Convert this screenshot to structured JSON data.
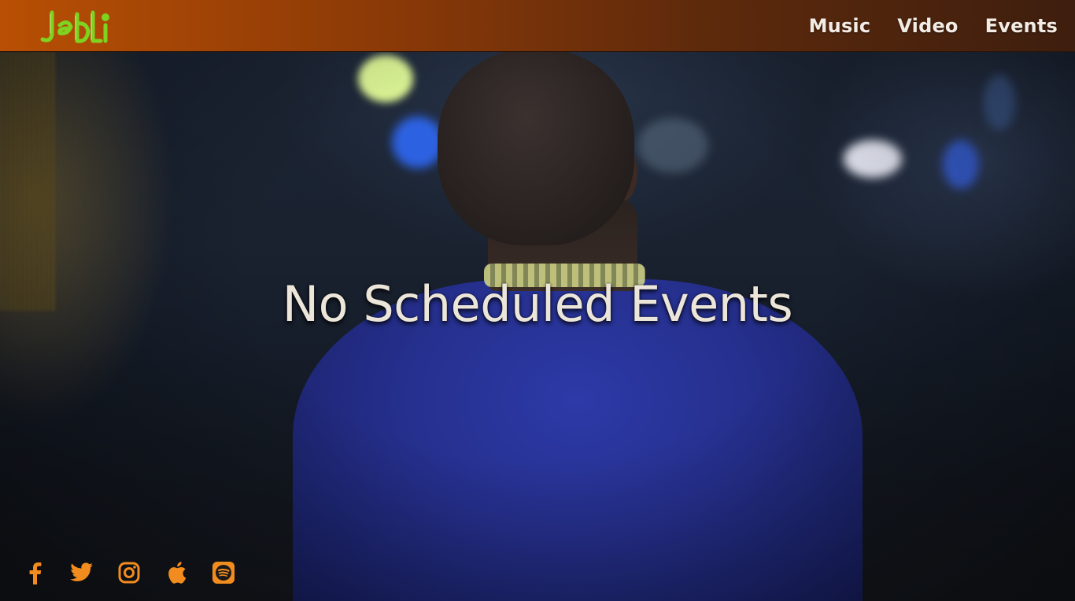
{
  "header": {
    "logo_text": "JeDLi",
    "nav": [
      {
        "label": "Music"
      },
      {
        "label": "Video"
      },
      {
        "label": "Events"
      }
    ]
  },
  "main": {
    "message": "No Scheduled Events"
  },
  "socials": [
    {
      "icon": "facebook-icon"
    },
    {
      "icon": "twitter-icon"
    },
    {
      "icon": "instagram-icon"
    },
    {
      "icon": "apple-icon"
    },
    {
      "icon": "spotify-icon"
    }
  ],
  "colors": {
    "accent": "#f28c1e",
    "logo_green": "#7ed321",
    "header_start": "#b84f04",
    "header_end": "#3e1e0e",
    "text": "#ece6da"
  }
}
